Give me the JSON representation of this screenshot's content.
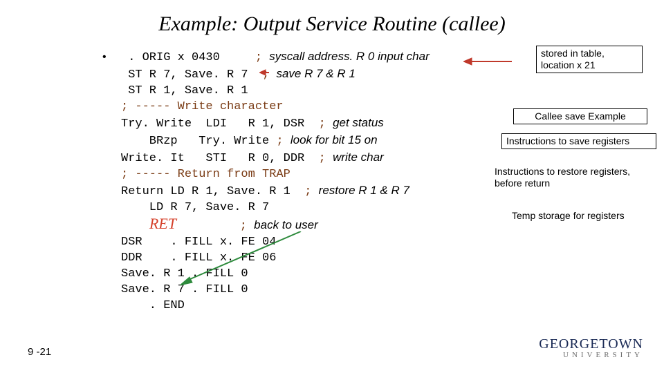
{
  "title": "Example: Output Service Routine (callee)",
  "bullet_mark": "•",
  "code": {
    "l1a": " . ORIG x 0430     ",
    "l1b": "; ",
    "l1c": "syscall address. R 0 input char",
    "l2a": " ST R 7, Save. R 7  ",
    "l2b": "; ",
    "l2c": "save R 7 & R 1",
    "l3": " ST R 1, Save. R 1",
    "l4": "; ----- Write character",
    "l5a": "Try. Write  LDI   R 1, DSR  ",
    "l5b": "; ",
    "l5c": "get status",
    "l6a": "    BRzp   Try. Write ",
    "l6b": "; ",
    "l6c": "look for bit 15 on",
    "l7a": "Write. It   STI   R 0, DDR  ",
    "l7b": "; ",
    "l7c": "write char",
    "l8": "; ----- Return from TRAP",
    "l9a": "Return LD R 1, Save. R 1  ",
    "l9b": "; ",
    "l9c": "restore R 1 & R 7",
    "l10": "    LD R 7, Save. R 7",
    "l11a": "    ",
    "l11b": "RET",
    "l11c": "         ",
    "l11d": "; ",
    "l11e": "back to user",
    "l12": "DSR    . FILL x. FE 04",
    "l13": "DDR    . FILL x. FE 06",
    "l14": "Save. R 1 . FILL 0",
    "l15": "Save. R 7 . FILL 0",
    "l16": "    . END"
  },
  "notes": {
    "n1": "stored in table,\nlocation x 21",
    "n2": "Callee save Example",
    "n3": "Instructions to save registers",
    "n4": "Instructions to restore registers,\nbefore return",
    "n5": "Temp storage for registers"
  },
  "slide_number": "9 -21",
  "logo_top": "GEORGETOWN",
  "logo_bottom": "UNIVERSITY",
  "chart_data": null
}
